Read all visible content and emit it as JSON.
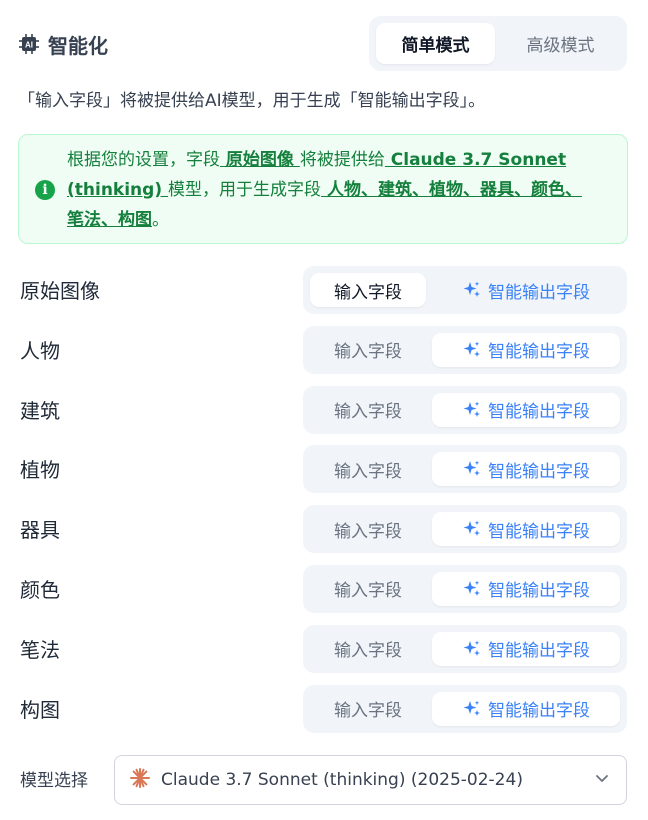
{
  "header": {
    "title": "智能化",
    "icon": "ai-chip-icon",
    "modes": [
      "简单模式",
      "高级模式"
    ],
    "active_mode": "简单模式"
  },
  "description": "「输入字段」将被提供给AI模型，用于生成「智能输出字段」。",
  "info": {
    "p1": "根据您的设置，字段",
    "input_field": " 原始图像 ",
    "p2": "将被提供给",
    "model": " Claude 3.7 Sonnet (thinking) ",
    "p3": "模型，用于生成字段",
    "output_fields": " 人物、建筑、植物、器具、颜色、笔法、构图",
    "p4": "。",
    "icon": "info-icon",
    "color": "#15803d"
  },
  "segment_labels": {
    "input": "输入字段",
    "output": "智能输出字段"
  },
  "fields": [
    {
      "label": "原始图像",
      "mode": "input"
    },
    {
      "label": "人物",
      "mode": "output"
    },
    {
      "label": "建筑",
      "mode": "output"
    },
    {
      "label": "植物",
      "mode": "output"
    },
    {
      "label": "器具",
      "mode": "output"
    },
    {
      "label": "颜色",
      "mode": "output"
    },
    {
      "label": "笔法",
      "mode": "output"
    },
    {
      "label": "构图",
      "mode": "output"
    }
  ],
  "model_select": {
    "label": "模型选择",
    "value": "Claude 3.7 Sonnet (thinking) (2025-02-24)",
    "icon": "claude-logo-icon",
    "accent": "#d97757"
  },
  "colors": {
    "accent_blue": "#3b82f6",
    "success_bg": "#f0fdf4"
  }
}
